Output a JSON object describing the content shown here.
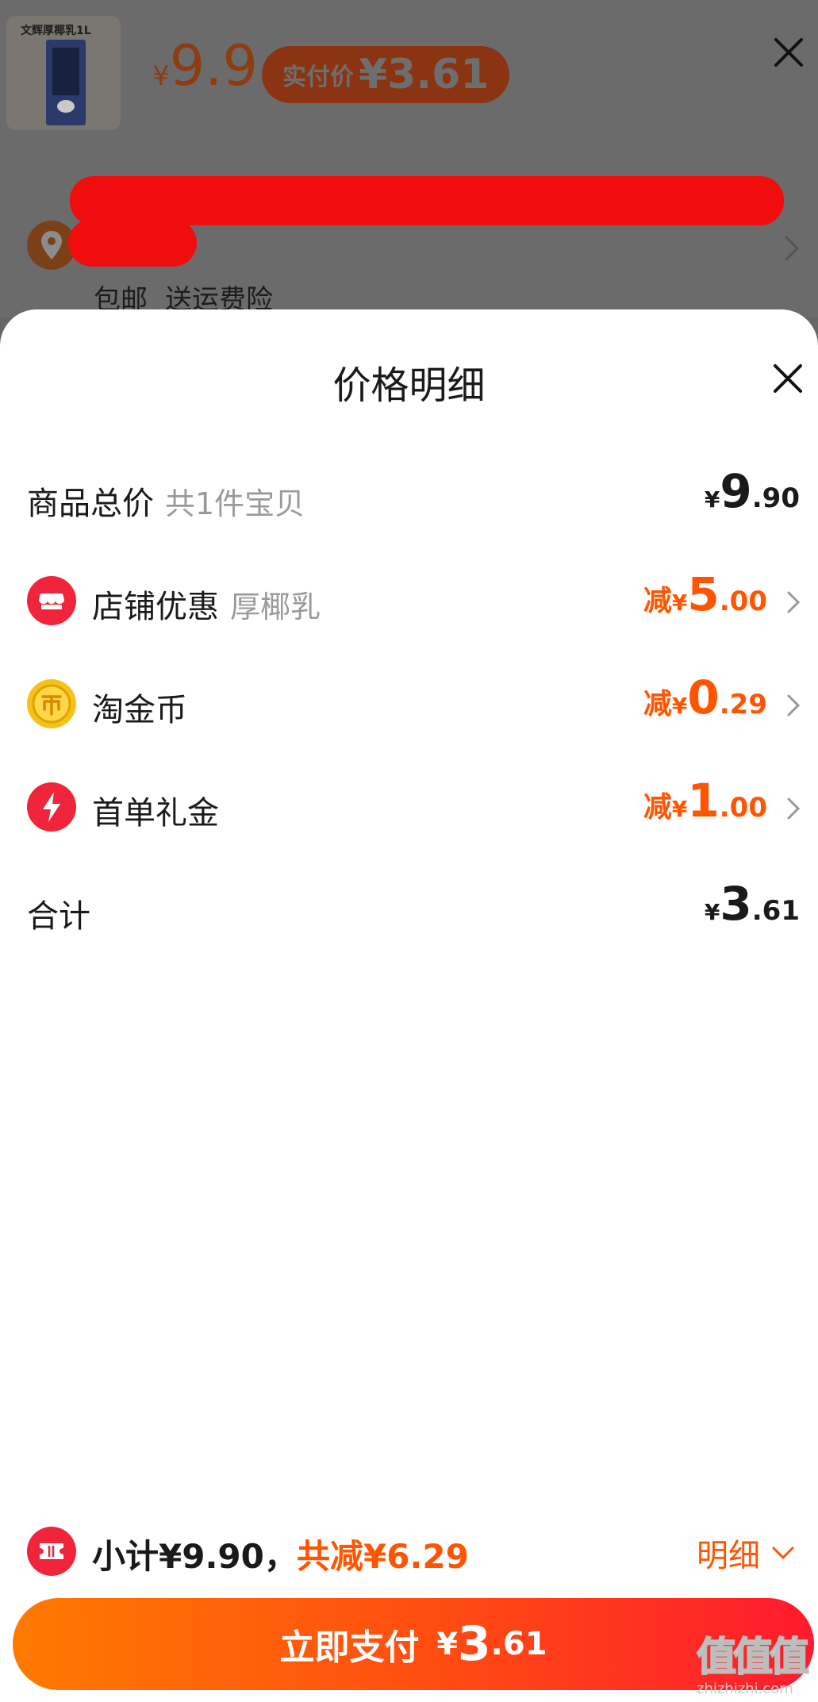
{
  "product_header": {
    "thumbnail_text": "文辉厚椰乳1L",
    "price_yen": "¥",
    "price_value": "9.9",
    "actual_pay_label": "实付价",
    "actual_pay_amount": "¥3.61",
    "shipping_tags": [
      "包邮",
      "送运费险"
    ],
    "colors": {
      "redaction": "#f10d0d"
    }
  },
  "sheet": {
    "title": "价格明细",
    "rows": [
      {
        "label": "商品总价",
        "sub": "共1件宝贝",
        "prefix": "",
        "yen": "¥",
        "int": "9",
        "dec": ".90",
        "tone": "black",
        "icon": ""
      },
      {
        "label": "店铺优惠",
        "sub": "厚椰乳",
        "prefix": "减",
        "yen": "¥",
        "int": "5",
        "dec": ".00",
        "tone": "orange",
        "icon": "shop-icon"
      },
      {
        "label": "淘金币",
        "sub": "",
        "prefix": "减",
        "yen": "¥",
        "int": "0",
        "dec": ".29",
        "tone": "orange",
        "icon": "gold-coin-icon"
      },
      {
        "label": "首单礼金",
        "sub": "",
        "prefix": "减",
        "yen": "¥",
        "int": "1",
        "dec": ".00",
        "tone": "orange",
        "icon": "lightning-icon"
      },
      {
        "label": "合计",
        "sub": "",
        "prefix": "",
        "yen": "¥",
        "int": "3",
        "dec": ".61",
        "tone": "black",
        "icon": ""
      }
    ]
  },
  "summary": {
    "subtotal": "小计¥9.90，",
    "saved": "共减¥6.29",
    "detail_toggle": "明细"
  },
  "pay_button": {
    "label": "立即支付",
    "yen": "¥",
    "int": "3",
    "dec": ".61"
  },
  "watermark": {
    "logo": "值值值",
    "url": "zhizhizhi.com"
  },
  "colors": {
    "accent_orange": "#ff5500",
    "icon_red": "#f0243a",
    "coin_gold": "#f5c21a",
    "button_gradient_start": "#ff7a00",
    "button_gradient_end": "#ff1a2e"
  }
}
